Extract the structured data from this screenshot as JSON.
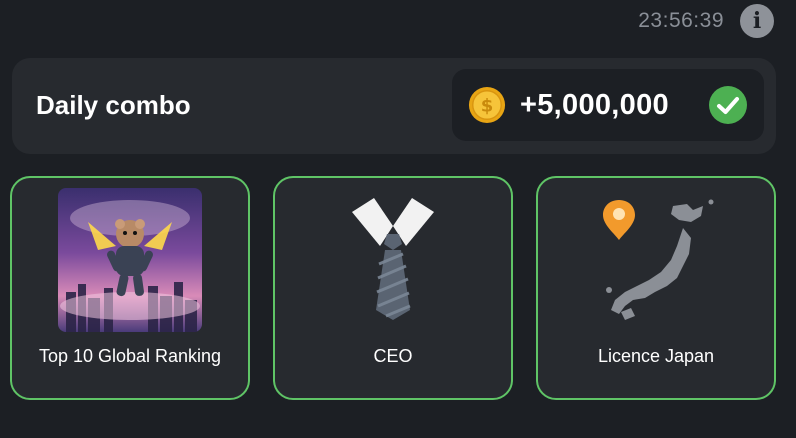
{
  "header": {
    "timer": "23:56:39",
    "info_icon": "info-icon"
  },
  "combo": {
    "title": "Daily combo",
    "reward": "+5,000,000",
    "coin_icon": "coin-icon",
    "status_icon": "check-icon"
  },
  "cards": [
    {
      "label": "Top 10 Global Ranking",
      "image": "hamster-astronaut-city-image",
      "completed": true
    },
    {
      "label": "CEO",
      "image": "tie-collar-icon",
      "completed": true
    },
    {
      "label": "Licence Japan",
      "image": "japan-map-pin-icon",
      "completed": true
    }
  ],
  "colors": {
    "accent_green": "#5fc466",
    "panel": "#272a2f",
    "background": "#1c1f24",
    "coin": "#f2b51f"
  }
}
